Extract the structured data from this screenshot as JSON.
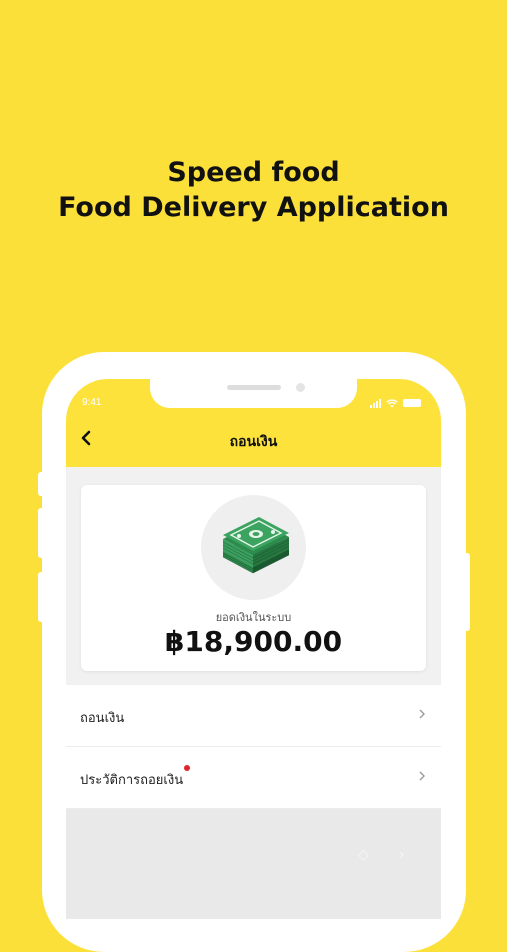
{
  "headline": {
    "line1": "Speed food",
    "line2": "Food Delivery Application"
  },
  "status_bar": {
    "time": "9:41"
  },
  "app_bar": {
    "back_icon": "chevron-left-icon",
    "title": "ถอนเงิน"
  },
  "balance": {
    "illustration": "money-stack-icon",
    "label": "ยอดเงินในระบบ",
    "amount": "฿18,900.00"
  },
  "menu": {
    "items": [
      {
        "label": "ถอนเงิน",
        "has_badge": false
      },
      {
        "label": "ประวัติการถอยเงิน",
        "has_badge": true
      }
    ],
    "chevron_icon": "chevron-right-icon"
  },
  "colors": {
    "background": "#FCE03A",
    "app_bar": "#FDE23C",
    "money_green": "#2E8B4E",
    "badge": "#E0262B"
  }
}
